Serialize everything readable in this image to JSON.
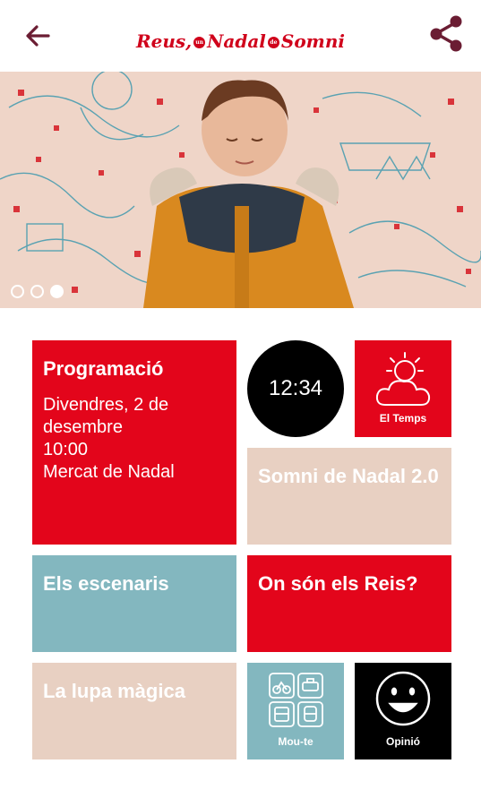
{
  "header": {
    "logo_reus": "Reus,",
    "logo_un": "un",
    "logo_nadal": "Nadal",
    "logo_de": "de",
    "logo_somni": "Somni"
  },
  "banner": {
    "slides": 3,
    "active_slide": 3
  },
  "tiles": {
    "programacio": {
      "title": "Programació",
      "date": "Divendres, 2 de desembre",
      "time": "10:00",
      "event": "Mercat de Nadal"
    },
    "clock": {
      "time": "12:34"
    },
    "temps": {
      "label": "El Temps"
    },
    "somni": {
      "title": "Somni de Nadal 2.0"
    },
    "escenaris": {
      "title": "Els escenaris"
    },
    "reis": {
      "title": "On són els Reis?"
    },
    "lupa": {
      "title": "La lupa màgica"
    },
    "moute": {
      "label": "Mou-te"
    },
    "opinio": {
      "label": "Opinió"
    }
  },
  "colors": {
    "red": "#e3051b",
    "beige": "#e8d0c2",
    "teal": "#83b7bf",
    "header_icon": "#6b1d33"
  }
}
